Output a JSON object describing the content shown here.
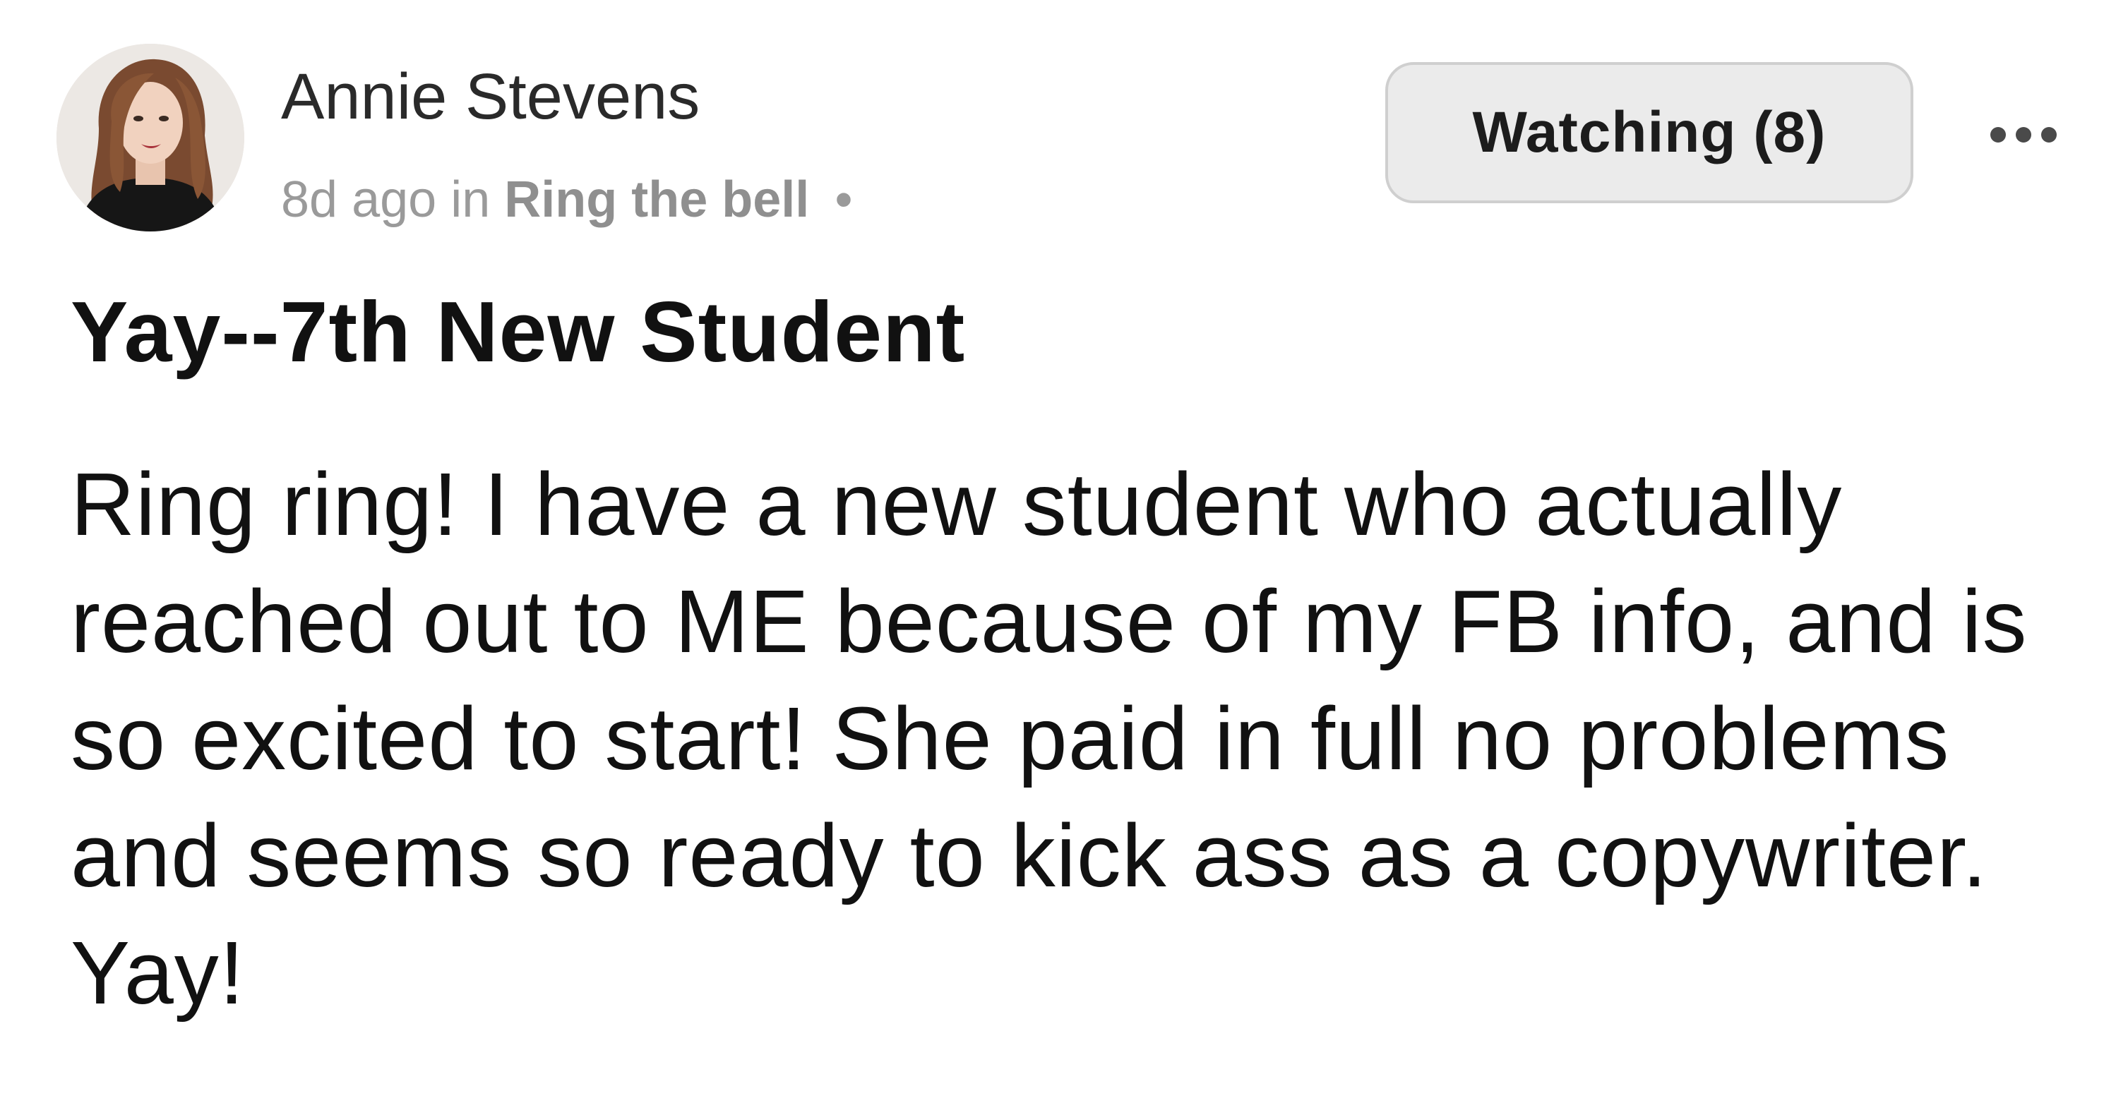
{
  "author": {
    "name": "Annie Stevens",
    "avatar_icon": "user-photo-avatar"
  },
  "meta": {
    "time_ago": "8d ago",
    "in_word": "in",
    "category": "Ring the bell",
    "separator": "•"
  },
  "actions": {
    "watch_label": "Watching (8)",
    "more_icon": "more-horizontal-icon"
  },
  "post": {
    "title": "Yay--7th New Student",
    "body": "Ring ring! I have a new student who actually reached out to ME because of my FB info, and is so excited to start! She paid in full no problems and seems so ready to kick ass as a copywriter. Yay!"
  },
  "colors": {
    "button_bg": "#ebebeb",
    "button_border": "#cfcfcf",
    "meta_text": "#9a9a9a"
  }
}
